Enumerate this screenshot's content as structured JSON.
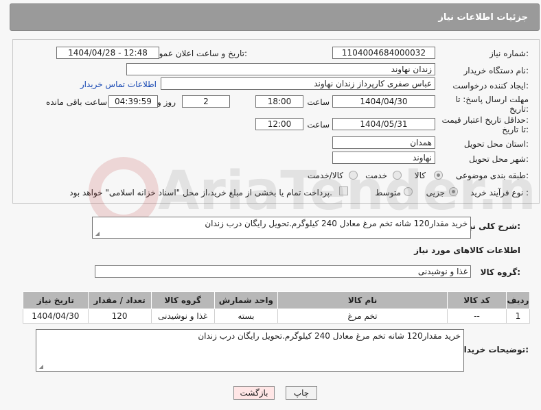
{
  "header": {
    "title": "جزئیات اطلاعات نیاز"
  },
  "form": {
    "need_number_label": "شماره نیاز:",
    "need_number": "1104004684000032",
    "announce_label": "تاریخ و ساعت اعلان عمومی:",
    "announce_value": "1404/04/28 - 12:48",
    "buyer_org_label": "نام دستگاه خریدار:",
    "buyer_org": "زندان نهاوند",
    "creator_label": "ایجاد کننده درخواست:",
    "creator": "عباس صفری کارپرداز زندان نهاوند",
    "contact_link": "اطلاعات تماس خریدار",
    "deadline_label_1": "مهلت ارسال پاسخ: تا",
    "deadline_label_2": "تاریخ:",
    "deadline_date": "1404/04/30",
    "time_label": "ساعت",
    "deadline_time": "18:00",
    "days_value": "2",
    "days_and_label": "روز و",
    "remaining_time": "04:39:59",
    "remaining_label": "ساعت باقی مانده",
    "min_price_label_1": "حداقل تاریخ اعتبار قیمت:",
    "min_price_label_2": "تا تاریخ:",
    "price_date": "1404/05/31",
    "price_time": "12:00",
    "province_label": "استان محل تحویل:",
    "province": "همدان",
    "city_label": "شهر محل تحویل:",
    "city": "نهاوند",
    "category_label": "طبقه بندی موضوعی:",
    "category_options": [
      "کالا",
      "خدمت",
      "کالا/خدمت"
    ],
    "process_label": "نوع فرآیند خرید :",
    "process_options": [
      "جزیی",
      "متوسط"
    ],
    "payment_note": "پرداخت تمام یا بخشی از مبلغ خرید،از محل \"اسناد خزانه اسلامی\" خواهد بود."
  },
  "description": {
    "label": "شرح کلی نیاز:",
    "text": "خرید مقدار120 شانه تخم مرغ معادل 240 کیلوگرم.تحویل رایگان درب زندان"
  },
  "goods": {
    "section_title": "اطلاعات کالاهای مورد نیاز",
    "group_label": "گروه کالا:",
    "group_value": "غذا و نوشیدنی",
    "columns": [
      "ردیف",
      "کد کالا",
      "نام کالا",
      "واحد شمارش",
      "گروه کالا",
      "تعداد / مقدار",
      "تاریخ نیاز"
    ],
    "rows": [
      [
        "1",
        "--",
        "تخم مرغ",
        "بسته",
        "غذا و نوشیدنی",
        "120",
        "1404/04/30"
      ]
    ]
  },
  "buyer_notes": {
    "label": "توضیحات خریدار:",
    "text": "خرید مقدار120 شانه تخم مرغ معادل 240 کیلوگرم.تحویل رایگان درب زندان"
  },
  "buttons": {
    "print": "چاپ",
    "back": "بازگشت"
  },
  "watermark_text": "AriaTender.net"
}
